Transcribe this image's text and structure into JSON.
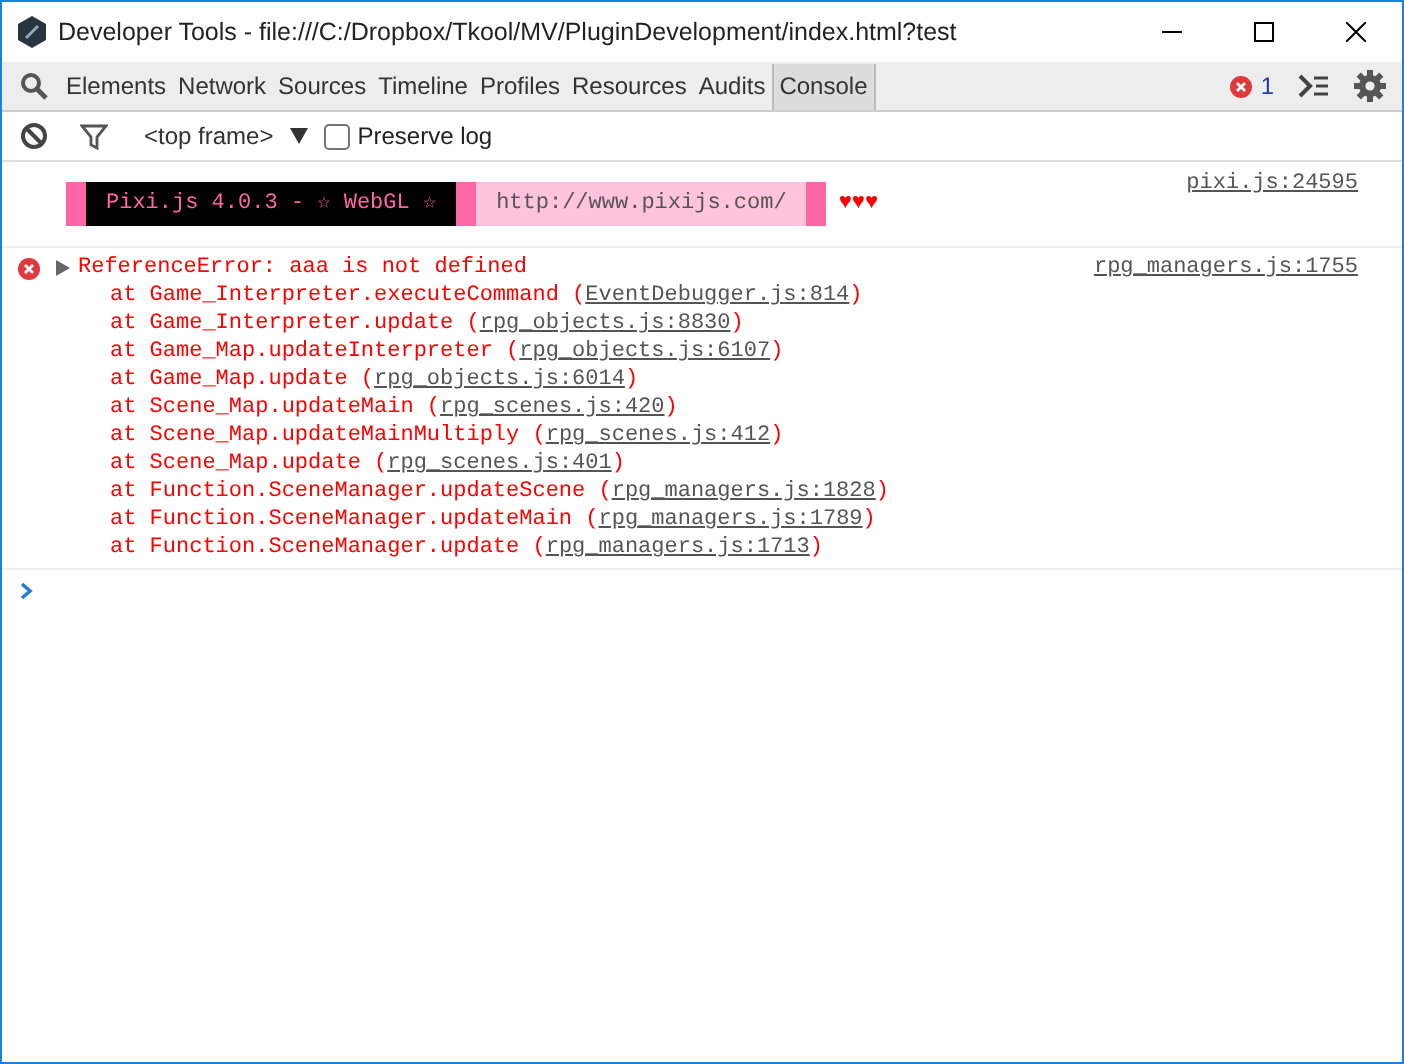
{
  "window": {
    "title": "Developer Tools - file:///C:/Dropbox/Tkool/MV/PluginDevelopment/index.html?test"
  },
  "tabs": [
    {
      "label": "Elements",
      "selected": false
    },
    {
      "label": "Network",
      "selected": false
    },
    {
      "label": "Sources",
      "selected": false
    },
    {
      "label": "Timeline",
      "selected": false
    },
    {
      "label": "Profiles",
      "selected": false
    },
    {
      "label": "Resources",
      "selected": false
    },
    {
      "label": "Audits",
      "selected": false
    },
    {
      "label": "Console",
      "selected": true
    }
  ],
  "error_count": "1",
  "filter_bar": {
    "context": "<top frame>",
    "preserve_log": {
      "label": "Preserve log",
      "checked": false
    }
  },
  "messages": [
    {
      "kind": "banner",
      "source": "pixi.js:24595",
      "segments": [
        {
          "kind": "stripe"
        },
        {
          "kind": "dark",
          "text": "Pixi.js 4.0.3 - ☆ WebGL ☆"
        },
        {
          "kind": "stripe"
        },
        {
          "kind": "light",
          "text": "http://www.pixijs.com/"
        },
        {
          "kind": "stripe"
        }
      ],
      "hearts": "♥♥♥"
    },
    {
      "kind": "error",
      "expanded": false,
      "source": "rpg_managers.js:1755",
      "text": "ReferenceError: aaa is not defined",
      "stack": [
        {
          "text": "at Game_Interpreter.executeCommand (",
          "link": "EventDebugger.js:814",
          "end": ")"
        },
        {
          "text": "at Game_Interpreter.update (",
          "link": "rpg_objects.js:8830",
          "end": ")"
        },
        {
          "text": "at Game_Map.updateInterpreter (",
          "link": "rpg_objects.js:6107",
          "end": ")"
        },
        {
          "text": "at Game_Map.update (",
          "link": "rpg_objects.js:6014",
          "end": ")"
        },
        {
          "text": "at Scene_Map.updateMain (",
          "link": "rpg_scenes.js:420",
          "end": ")"
        },
        {
          "text": "at Scene_Map.updateMainMultiply (",
          "link": "rpg_scenes.js:412",
          "end": ")"
        },
        {
          "text": "at Scene_Map.update (",
          "link": "rpg_scenes.js:401",
          "end": ")"
        },
        {
          "text": "at Function.SceneManager.updateScene (",
          "link": "rpg_managers.js:1828",
          "end": ")"
        },
        {
          "text": "at Function.SceneManager.updateMain (",
          "link": "rpg_managers.js:1789",
          "end": ")"
        },
        {
          "text": "at Function.SceneManager.update (",
          "link": "rpg_managers.js:1713",
          "end": ")"
        }
      ]
    }
  ]
}
